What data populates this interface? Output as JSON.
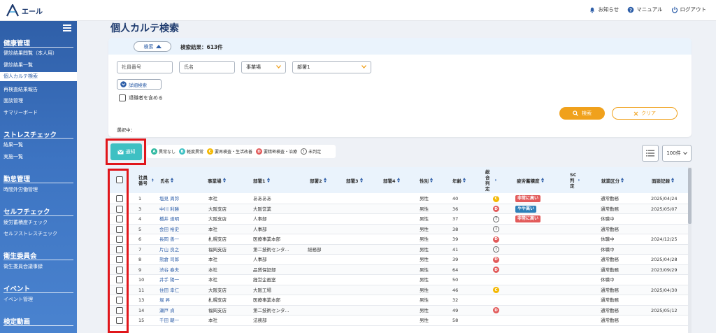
{
  "header": {
    "logo_text": "エール",
    "actions": [
      {
        "icon": "bell-icon",
        "label": "お知らせ"
      },
      {
        "icon": "help-icon",
        "label": "マニュアル"
      },
      {
        "icon": "power-icon",
        "label": "ログアウト"
      }
    ]
  },
  "sidebar": {
    "sections": [
      {
        "title": "健康管理",
        "items": [
          "健診結果閲覧（本人用）",
          "健診結果一覧",
          "個人カルテ検索",
          "再検査結果報告",
          "面談管理",
          "サマリーボード"
        ]
      },
      {
        "title": "ストレスチェック",
        "items": [
          "結果一覧",
          "実施一覧"
        ]
      },
      {
        "title": "勤怠管理",
        "items": [
          "時間外労働管理"
        ]
      },
      {
        "title": "セルフチェック",
        "items": [
          "疲労蓄積度チェック",
          "セルフストレスチェック"
        ]
      },
      {
        "title": "衛生委員会",
        "items": [
          "衛生委員会議事録"
        ]
      },
      {
        "title": "イベント",
        "items": [
          "イベント管理"
        ]
      },
      {
        "title": "検定動画",
        "items": []
      }
    ],
    "active_item": "個人カルテ検索"
  },
  "page": {
    "title": "個人カルテ検索"
  },
  "search": {
    "toggle_label": "検索",
    "result_count": "検索結果：613件",
    "employee_no_placeholder": "社員番号",
    "name_placeholder": "氏名",
    "office_select": "事業場",
    "dept_select": "部署1",
    "detail_label": "詳細検索",
    "retired_label": "退職者を含める",
    "search_button": "検索",
    "clear_button": "クリア",
    "selected_label": "選択中："
  },
  "toolbar": {
    "notify_label": "通知",
    "legend": [
      {
        "code": "A",
        "label": "異常なし"
      },
      {
        "code": "B",
        "label": "軽度異常"
      },
      {
        "code": "C",
        "label": "要再検査・生活改善"
      },
      {
        "code": "D",
        "label": "要精密検査・治療"
      },
      {
        "code": "!",
        "label": "未判定"
      }
    ],
    "per_page": "100件"
  },
  "table": {
    "headers": {
      "emp_no": "社員番号",
      "name": "氏名",
      "office": "事業場",
      "dept1": "部署1",
      "dept2": "部署2",
      "dept3": "部署3",
      "dept4": "部署4",
      "gender": "性別",
      "age": "年齢",
      "judgment": "総合判定",
      "fatigue": "疲労蓄積度",
      "sc": "SC判定",
      "employment": "就業区分",
      "interview": "面談記録"
    },
    "rows": [
      {
        "no": "1",
        "name": "塩見 周弥",
        "office": "本社",
        "dept1": "ああああ",
        "dept2": "",
        "gender": "男性",
        "age": "40",
        "judgment": "C",
        "fatigue": "非常に高い",
        "fatigue_color": "red",
        "employment": "通常勤務",
        "interview": "2025/04/24"
      },
      {
        "no": "3",
        "name": "中川 利勝",
        "office": "大阪支店",
        "dept1": "大阪営業",
        "dept2": "",
        "gender": "男性",
        "age": "36",
        "judgment": "D",
        "fatigue": "やや高い",
        "fatigue_color": "blue",
        "employment": "通常勤務",
        "interview": "2025/05/07"
      },
      {
        "no": "4",
        "name": "橋井 達明",
        "office": "大阪支店",
        "dept1": "人事部",
        "dept2": "",
        "gender": "男性",
        "age": "37",
        "judgment": "!",
        "fatigue": "非常に高い",
        "fatigue_color": "red",
        "employment": "休職中",
        "interview": ""
      },
      {
        "no": "5",
        "name": "会田 裕史",
        "office": "本社",
        "dept1": "人事部",
        "dept2": "",
        "gender": "男性",
        "age": "38",
        "judgment": "!",
        "fatigue": "",
        "fatigue_color": "",
        "employment": "通常勤務",
        "interview": ""
      },
      {
        "no": "6",
        "name": "長岡 善一",
        "office": "札幌支店",
        "dept1": "医療事業本部",
        "dept2": "",
        "gender": "男性",
        "age": "39",
        "judgment": "D",
        "fatigue": "",
        "fatigue_color": "",
        "employment": "休職中",
        "interview": "2024/12/25"
      },
      {
        "no": "7",
        "name": "片山 良之",
        "office": "福岡支店",
        "dept1": "第二技術センタ...",
        "dept2": "総務部",
        "gender": "男性",
        "age": "41",
        "judgment": "!",
        "fatigue": "",
        "fatigue_color": "",
        "employment": "休職中",
        "interview": ""
      },
      {
        "no": "8",
        "name": "熊倉 司郎",
        "office": "本社",
        "dept1": "人事部",
        "dept2": "",
        "gender": "男性",
        "age": "39",
        "judgment": "D",
        "fatigue": "",
        "fatigue_color": "",
        "employment": "通常勤務",
        "interview": "2025/04/28"
      },
      {
        "no": "9",
        "name": "渋谷 春夫",
        "office": "本社",
        "dept1": "品質保証部",
        "dept2": "",
        "gender": "男性",
        "age": "64",
        "judgment": "D",
        "fatigue": "",
        "fatigue_color": "",
        "employment": "通常勤務",
        "interview": "2023/09/29"
      },
      {
        "no": "10",
        "name": "井手 陽一",
        "office": "本社",
        "dept1": "経営企画室",
        "dept2": "",
        "gender": "男性",
        "age": "50",
        "judgment": "",
        "fatigue": "",
        "fatigue_color": "",
        "employment": "休職中",
        "interview": ""
      },
      {
        "no": "11",
        "name": "住田 幸仁",
        "office": "大阪支店",
        "dept1": "大阪工場",
        "dept2": "",
        "gender": "男性",
        "age": "46",
        "judgment": "C",
        "fatigue": "",
        "fatigue_color": "",
        "employment": "通常勤務",
        "interview": "2025/04/30"
      },
      {
        "no": "13",
        "name": "堀 昇",
        "office": "札幌支店",
        "dept1": "医療事業本部",
        "dept2": "",
        "gender": "男性",
        "age": "32",
        "judgment": "",
        "fatigue": "",
        "fatigue_color": "",
        "employment": "通常勤務",
        "interview": ""
      },
      {
        "no": "14",
        "name": "瀬戸 貞",
        "office": "福岡支店",
        "dept1": "第二技術センタ...",
        "dept2": "",
        "gender": "男性",
        "age": "49",
        "judgment": "D",
        "fatigue": "",
        "fatigue_color": "",
        "employment": "通常勤務",
        "interview": "2025/05/12"
      },
      {
        "no": "15",
        "name": "千田 朝一",
        "office": "本社",
        "dept1": "法務部",
        "dept2": "",
        "gender": "男性",
        "age": "58",
        "judgment": "",
        "fatigue": "",
        "fatigue_color": "",
        "employment": "通常勤務",
        "interview": ""
      }
    ]
  },
  "colors": {
    "primary": "#2f5fa8",
    "accent": "#f0a11c",
    "teal": "#3ec0c3",
    "highlight": "#e0161b"
  }
}
